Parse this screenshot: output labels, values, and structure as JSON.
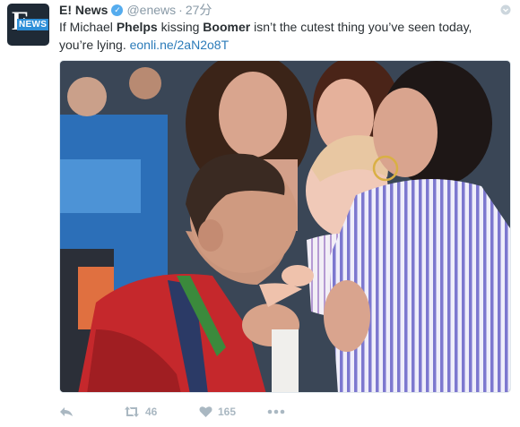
{
  "tweet": {
    "author_name": "E! News",
    "handle": "@enews",
    "separator": "·",
    "time": "27分",
    "verified_mark": "✓",
    "avatar": {
      "main": "E",
      "badge": "NEWS",
      "icon": "enews-logo"
    },
    "text": {
      "t1": "If Michael ",
      "b1": "Phelps",
      "t2": " kissing ",
      "b2": "Boomer",
      "t3": " isn’t the cutest thing you’ve seen today, you’re lying. ",
      "link": "eonli.ne/2aN2o8T"
    },
    "media": {
      "description_icon": "photo"
    },
    "actions": {
      "retweet_count": "46",
      "like_count": "165"
    }
  },
  "colors": {
    "link": "#2b7bb9",
    "verified": "#55acee",
    "meta": "#8899a6",
    "action": "#aab8c2"
  }
}
